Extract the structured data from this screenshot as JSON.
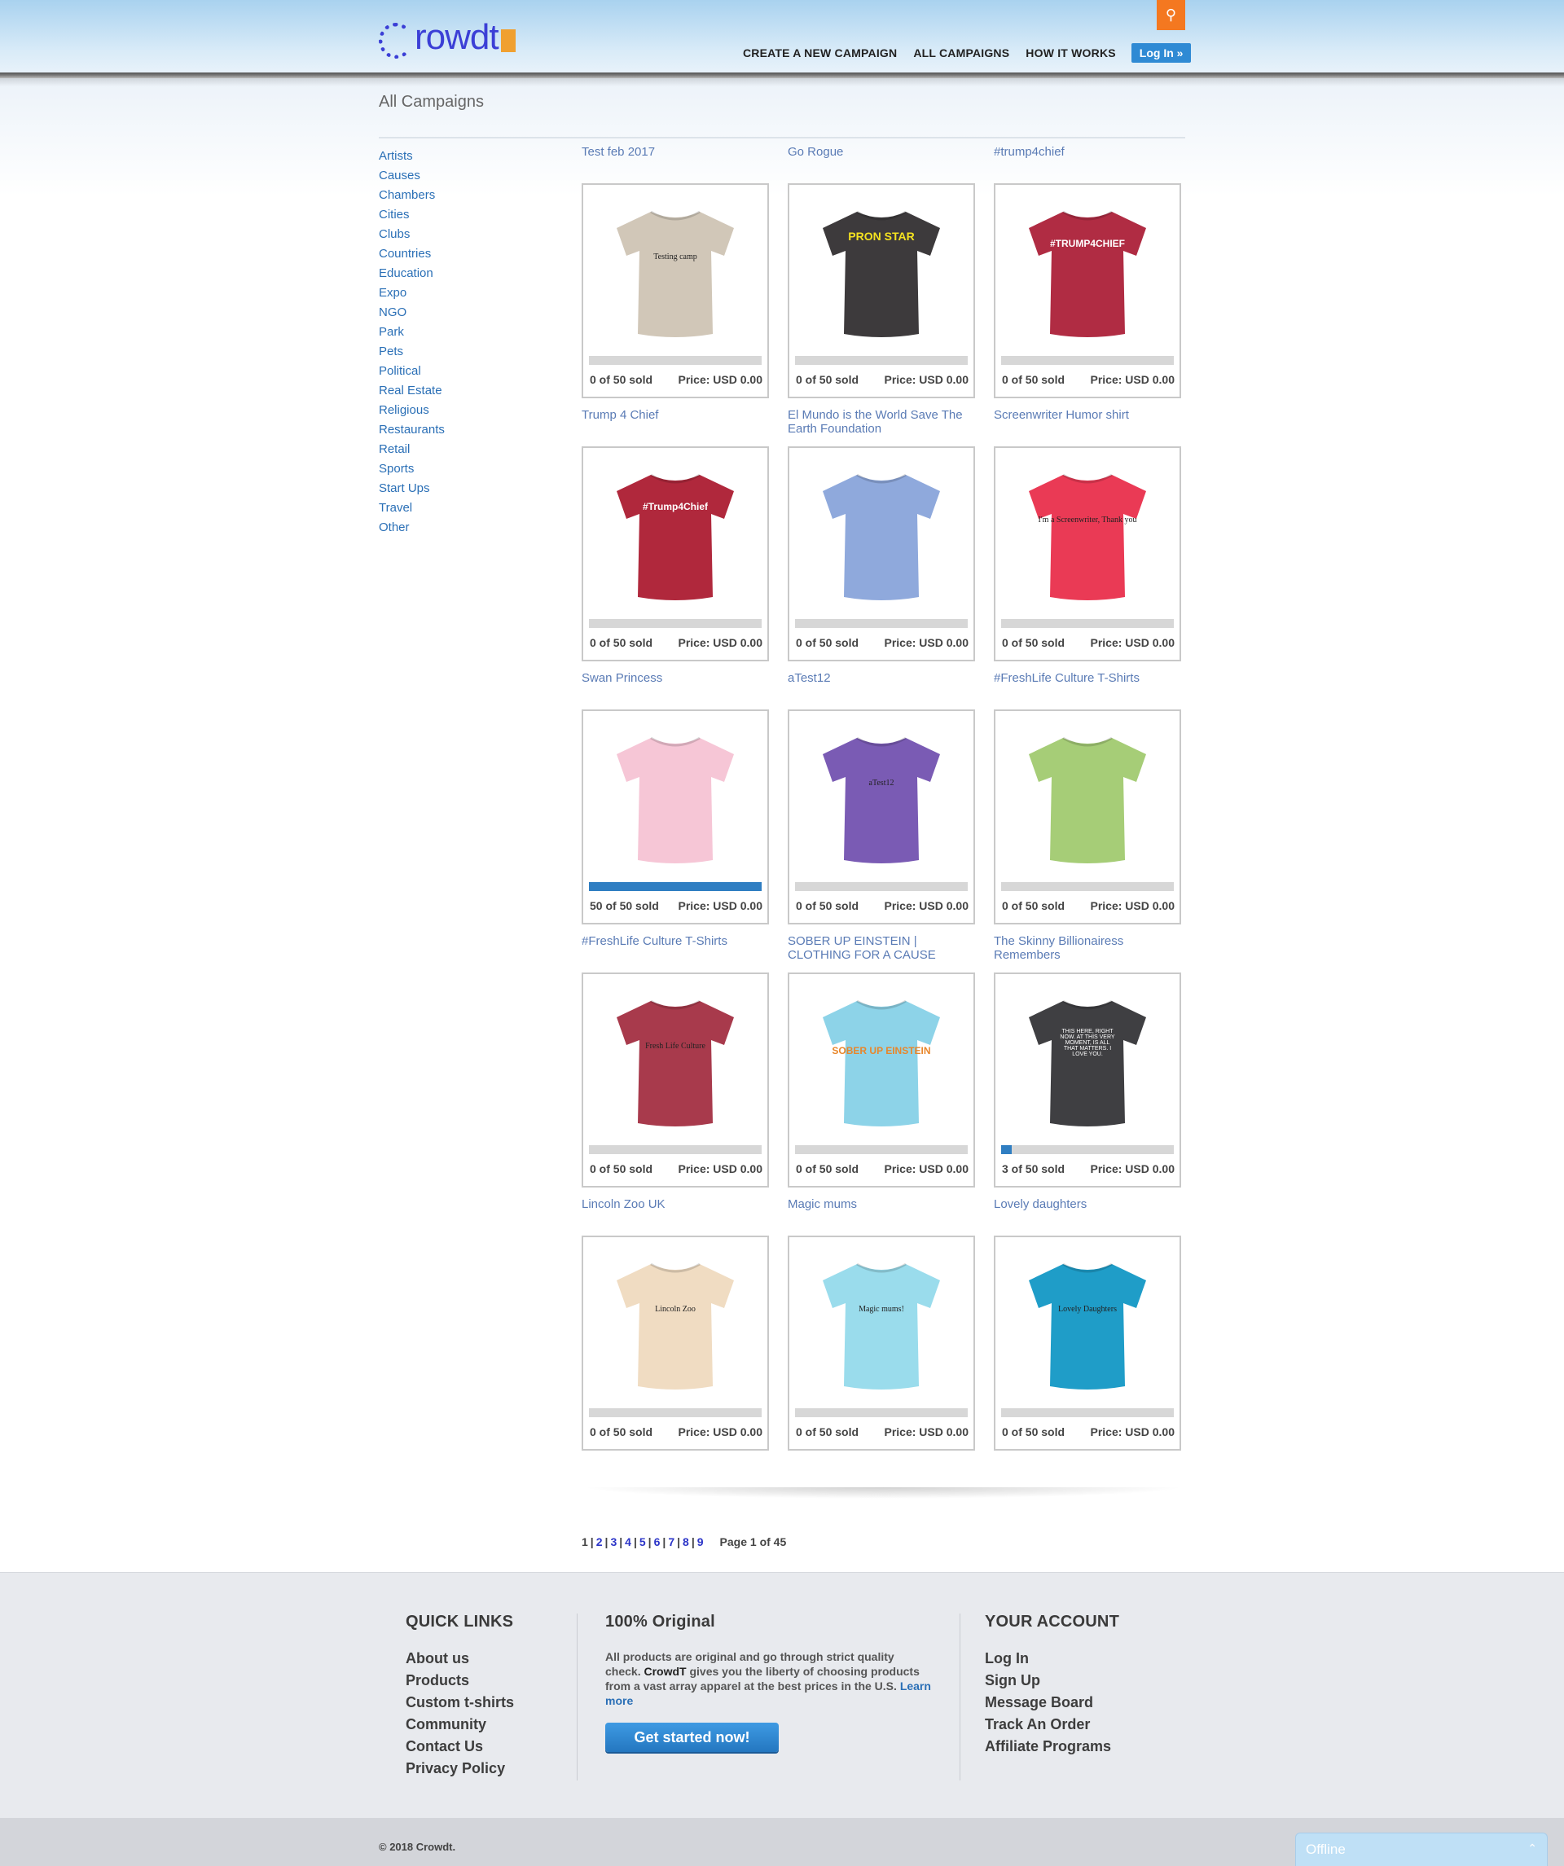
{
  "header": {
    "logo_text": "rowdt",
    "nav": [
      "CREATE A NEW CAMPAIGN",
      "ALL CAMPAIGNS",
      "HOW IT WORKS"
    ],
    "login_label": "Log In »",
    "search_icon": "search-icon"
  },
  "main": {
    "title": "All Campaigns"
  },
  "sidebar": {
    "categories": [
      "Artists",
      "Causes",
      "Chambers",
      "Cities",
      "Clubs",
      "Countries",
      "Education",
      "Expo",
      "NGO",
      "Park",
      "Pets",
      "Political",
      "Real Estate",
      "Religious",
      "Restaurants",
      "Retail",
      "Sports",
      "Start Ups",
      "Travel",
      "Other"
    ]
  },
  "campaigns": [
    {
      "title": "Test feb 2017",
      "sold": "0 of 50 sold",
      "price": "Price: USD 0.00",
      "progress": 0,
      "shirt_color": "#d1c7b8",
      "shirt_text": "Testing camp",
      "text_style": "small"
    },
    {
      "title": "Go Rogue",
      "sold": "0 of 50 sold",
      "price": "Price: USD 0.00",
      "progress": 0,
      "shirt_color": "#3d3a3c",
      "shirt_text": "PRON STAR",
      "text_style": "yellow"
    },
    {
      "title": "#trump4chief",
      "sold": "0 of 50 sold",
      "price": "Price: USD 0.00",
      "progress": 0,
      "shirt_color": "#b02c43",
      "shirt_text": "#TRUMP4CHIEF",
      "text_style": "big"
    },
    {
      "title": "Trump 4 Chief",
      "sold": "0 of 50 sold",
      "price": "Price: USD 0.00",
      "progress": 0,
      "shirt_color": "#b0283c",
      "shirt_text": "#Trump4Chief",
      "text_style": "big"
    },
    {
      "title": "El Mundo is the World Save The Earth Foundation",
      "sold": "0 of 50 sold",
      "price": "Price: USD 0.00",
      "progress": 0,
      "shirt_color": "#8fa9dc",
      "shirt_text": "",
      "text_style": "small"
    },
    {
      "title": "Screenwriter Humor shirt",
      "sold": "0 of 50 sold",
      "price": "Price: USD 0.00",
      "progress": 0,
      "shirt_color": "#ea3a55",
      "shirt_text": "I'm a Screenwriter, Thank you",
      "text_style": "small"
    },
    {
      "title": "Swan Princess",
      "sold": "50 of 50 sold",
      "price": "Price: USD 0.00",
      "progress": 1.0,
      "shirt_color": "#f6c6d6",
      "shirt_text": "",
      "text_style": "small"
    },
    {
      "title": "aTest12",
      "sold": "0 of 50 sold",
      "price": "Price: USD 0.00",
      "progress": 0,
      "shirt_color": "#7a5bb4",
      "shirt_text": "aTest12",
      "text_style": "small"
    },
    {
      "title": "#FreshLife Culture T-Shirts",
      "sold": "0 of 50 sold",
      "price": "Price: USD 0.00",
      "progress": 0,
      "shirt_color": "#a6cd77",
      "shirt_text": "",
      "text_style": "small"
    },
    {
      "title": "#FreshLife Culture T-Shirts",
      "sold": "0 of 50 sold",
      "price": "Price: USD 0.00",
      "progress": 0,
      "shirt_color": "#a83a4c",
      "shirt_text": "Fresh Life Culture",
      "text_style": "small"
    },
    {
      "title": "SOBER UP EINSTEIN | CLOTHING FOR A CAUSE",
      "sold": "0 of 50 sold",
      "price": "Price: USD 0.00",
      "progress": 0,
      "shirt_color": "#8dd3e8",
      "shirt_text": "SOBER UP EINSTEIN",
      "text_style": "orange"
    },
    {
      "title": "The Skinny Billionairess Remembers",
      "sold": "3 of 50 sold",
      "price": "Price: USD 0.00",
      "progress": 0.06,
      "shirt_color": "#3f3f42",
      "shirt_text": "THIS HERE, RIGHT NOW. AT THIS VERY MOMENT, IS ALL THAT MATTERS. I LOVE YOU.",
      "text_style": "white"
    },
    {
      "title": "Lincoln Zoo UK",
      "sold": "0 of 50 sold",
      "price": "Price: USD 0.00",
      "progress": 0,
      "shirt_color": "#f0dcc2",
      "shirt_text": "Lincoln Zoo",
      "text_style": "small"
    },
    {
      "title": "Magic mums",
      "sold": "0 of 50 sold",
      "price": "Price: USD 0.00",
      "progress": 0,
      "shirt_color": "#9adcec",
      "shirt_text": "Magic mums!",
      "text_style": "small"
    },
    {
      "title": "Lovely daughters",
      "sold": "0 of 50 sold",
      "price": "Price: USD 0.00",
      "progress": 0,
      "shirt_color": "#1f9dc8",
      "shirt_text": "Lovely Daughters",
      "text_style": "small"
    }
  ],
  "pagination": {
    "current": "1",
    "pages": [
      "2",
      "3",
      "4",
      "5",
      "6",
      "7",
      "8",
      "9"
    ],
    "info": "Page 1 of 45"
  },
  "footer": {
    "quick_links_title": "QUICK LINKS",
    "quick_links": [
      "About us",
      "Products",
      "Custom t-shirts",
      "Community",
      "Contact Us",
      "Privacy Policy"
    ],
    "original_title": "100% Original",
    "original_text_1": "All products are original and go through strict quality check.",
    "original_brand": "CrowdT",
    "original_text_2": "gives you the liberty of choosing products from a vast array apparel at the best prices in the U.S.",
    "learn_more": "Learn more",
    "cta_label": "Get started now!",
    "account_title": "YOUR ACCOUNT",
    "account_links": [
      "Log In",
      "Sign Up",
      "Message Board",
      "Track An Order",
      "Affiliate Programs"
    ],
    "copyright": "© 2018 Crowdt.",
    "chat_status": "Offline"
  }
}
